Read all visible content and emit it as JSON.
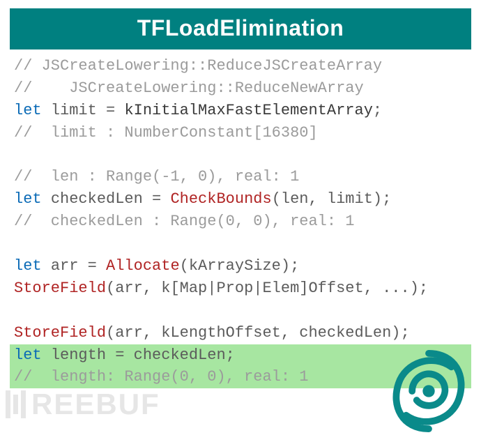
{
  "title": "TFLoadElimination",
  "code": {
    "l1": {
      "comment": "// JSCreateLowering::ReduceJSCreateArray"
    },
    "l2": {
      "comment": "//    JSCreateLowering::ReduceNewArray"
    },
    "l3": {
      "let": "let",
      "name": "limit",
      "eq": " = ",
      "rhs": "kInitialMaxFastElementArray",
      "semi": ";"
    },
    "l4": {
      "comment": "//  limit : NumberConstant[16380]"
    },
    "l5": {
      "blank": " "
    },
    "l6": {
      "comment": "//  len : Range(-1, 0), real: 1"
    },
    "l7": {
      "let": "let",
      "name": "checkedLen",
      "eq": " = ",
      "fn": "CheckBounds",
      "args": "(len, limit)",
      "semi": ";"
    },
    "l8": {
      "comment": "//  checkedLen : Range(0, 0), real: 1"
    },
    "l9": {
      "blank": " "
    },
    "l10": {
      "let": "let",
      "name": "arr",
      "eq": " = ",
      "fn": "Allocate",
      "args": "(kArraySize)",
      "semi": ";"
    },
    "l11": {
      "fn": "StoreField",
      "args": "(arr, k[Map|Prop|Elem]Offset, ...)",
      "semi": ";"
    },
    "l12": {
      "blank": " "
    },
    "l13": {
      "fn": "StoreField",
      "args": "(arr, kLengthOffset, checkedLen)",
      "semi": ";"
    },
    "l14": {
      "let": "let",
      "name": "length",
      "eq": " = ",
      "rhs": "checkedLen",
      "semi": ";"
    },
    "l15": {
      "comment": "//  length: Range(0, 0), real: 1"
    }
  },
  "watermark": "REEBUF",
  "colors": {
    "title_bg": "#008080",
    "highlight_bg": "#a7e6a1",
    "keyword": "#0a6ab6",
    "function_red": "#b02424",
    "comment": "#9b9b9b",
    "swirl": "#0a8a8a"
  }
}
